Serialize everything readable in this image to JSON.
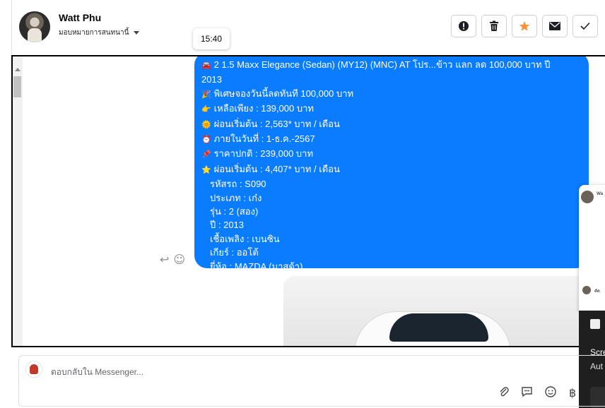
{
  "header": {
    "contact_name": "Watt Phu",
    "assign_label": "มอบหมายการสนทนานี้",
    "actions": [
      {
        "name": "spam",
        "icon": "exclamation-circle-icon"
      },
      {
        "name": "delete",
        "icon": "trash-icon"
      },
      {
        "name": "star",
        "icon": "star-icon",
        "color": "#f7923b"
      },
      {
        "name": "mark-unread",
        "icon": "envelope-icon"
      },
      {
        "name": "done",
        "icon": "checkmark-icon"
      }
    ]
  },
  "tooltip": {
    "time": "15:40"
  },
  "message": {
    "lines": [
      {
        "emoji": "🚘",
        "text": "2 1.5 Maxx Elegance (Sedan) (MY12) (MNC) AT โปร...ข้าว แลก ลด 100,000 บาท ปี"
      },
      {
        "emoji": "",
        "text": "2013"
      },
      {
        "emoji": "🎉",
        "text": "พิเศษจองวันนี้ลดทันที 100,000 บาท"
      },
      {
        "emoji": "👉",
        "text": "เหลือเพียง : 139,000 บาท"
      },
      {
        "emoji": "🌞",
        "text": "ผ่อนเริ่มต้น : 2,563* บาท / เดือน"
      },
      {
        "emoji": "⏰",
        "text": "ภายในวันที่ : 1-ธ.ค.-2567"
      },
      {
        "emoji": "📌",
        "text": "ราคาปกติ : 239,000 บาท"
      },
      {
        "emoji": "⭐",
        "text": "ผ่อนเริ่มต้น : 4,407* บาท / เดือน"
      }
    ],
    "details": [
      "รหัสรถ : S090",
      "ประเภท : เก๋ง",
      "รุ่น : 2 (สอง)",
      "ปี : 2013",
      "เชื้อเพลิง : เบนซิน",
      "เกียร์ : ออโต้",
      "ยี่ห้อ : MAZDA (มาสด้า)"
    ],
    "bubble_color": "#0a7cff"
  },
  "side_window": {
    "name_snippet": "Wa",
    "reply_snippet": "คัด"
  },
  "notification": {
    "title": "Scre",
    "subtitle": "Aut"
  },
  "composer": {
    "placeholder": "ตอบกลับใน Messenger...",
    "tools": [
      "paperclip-icon",
      "saved-reply-icon",
      "emoji-icon",
      "baht-icon"
    ]
  }
}
